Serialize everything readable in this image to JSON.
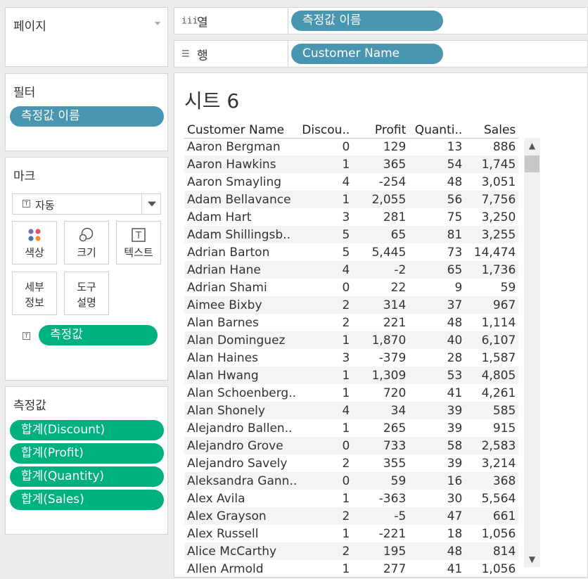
{
  "pages_panel": {
    "title": "페이지"
  },
  "filters_panel": {
    "title": "필터",
    "pill": "측정값 이름"
  },
  "marks_panel": {
    "title": "마크",
    "mark_type": "자동",
    "buttons": {
      "color": "색상",
      "size": "크기",
      "text": "텍스트",
      "detail_1": "세부",
      "detail_2": "정보",
      "tooltip_1": "도구",
      "tooltip_2": "설명"
    },
    "pill": "측정값"
  },
  "measures_panel": {
    "title": "측정값",
    "pills": [
      "합계(Discount)",
      "합계(Profit)",
      "합계(Quantity)",
      "합계(Sales)"
    ]
  },
  "columns_shelf": {
    "label": "열",
    "pill": "측정값 이름"
  },
  "rows_shelf": {
    "label": "행",
    "pill": "Customer Name"
  },
  "sheet": {
    "title": "시트 6",
    "headers": [
      "Customer Name",
      "Discou..",
      "Profit",
      "Quanti..",
      "Sales"
    ],
    "rows": [
      [
        "Aaron Bergman",
        "0",
        "129",
        "13",
        "886"
      ],
      [
        "Aaron Hawkins",
        "1",
        "365",
        "54",
        "1,745"
      ],
      [
        "Aaron Smayling",
        "4",
        "-254",
        "48",
        "3,051"
      ],
      [
        "Adam Bellavance",
        "1",
        "2,055",
        "56",
        "7,756"
      ],
      [
        "Adam Hart",
        "3",
        "281",
        "75",
        "3,250"
      ],
      [
        "Adam Shillingsb..",
        "5",
        "65",
        "81",
        "3,255"
      ],
      [
        "Adrian Barton",
        "5",
        "5,445",
        "73",
        "14,474"
      ],
      [
        "Adrian Hane",
        "4",
        "-2",
        "65",
        "1,736"
      ],
      [
        "Adrian Shami",
        "0",
        "22",
        "9",
        "59"
      ],
      [
        "Aimee Bixby",
        "2",
        "314",
        "37",
        "967"
      ],
      [
        "Alan Barnes",
        "2",
        "221",
        "48",
        "1,114"
      ],
      [
        "Alan Dominguez",
        "1",
        "1,870",
        "40",
        "6,107"
      ],
      [
        "Alan Haines",
        "3",
        "-379",
        "28",
        "1,587"
      ],
      [
        "Alan Hwang",
        "1",
        "1,309",
        "53",
        "4,805"
      ],
      [
        "Alan Schoenberg..",
        "1",
        "720",
        "41",
        "4,261"
      ],
      [
        "Alan Shonely",
        "4",
        "34",
        "39",
        "585"
      ],
      [
        "Alejandro Ballen..",
        "1",
        "265",
        "39",
        "915"
      ],
      [
        "Alejandro Grove",
        "0",
        "733",
        "58",
        "2,583"
      ],
      [
        "Alejandro Savely",
        "2",
        "355",
        "39",
        "3,214"
      ],
      [
        "Aleksandra Gann..",
        "0",
        "59",
        "16",
        "368"
      ],
      [
        "Alex Avila",
        "1",
        "-363",
        "30",
        "5,564"
      ],
      [
        "Alex Grayson",
        "2",
        "-5",
        "47",
        "661"
      ],
      [
        "Alex Russell",
        "1",
        "-221",
        "18",
        "1,056"
      ],
      [
        "Alice McCarthy",
        "2",
        "195",
        "48",
        "814"
      ],
      [
        "Allen Armold",
        "1",
        "277",
        "41",
        "1,056"
      ]
    ]
  }
}
